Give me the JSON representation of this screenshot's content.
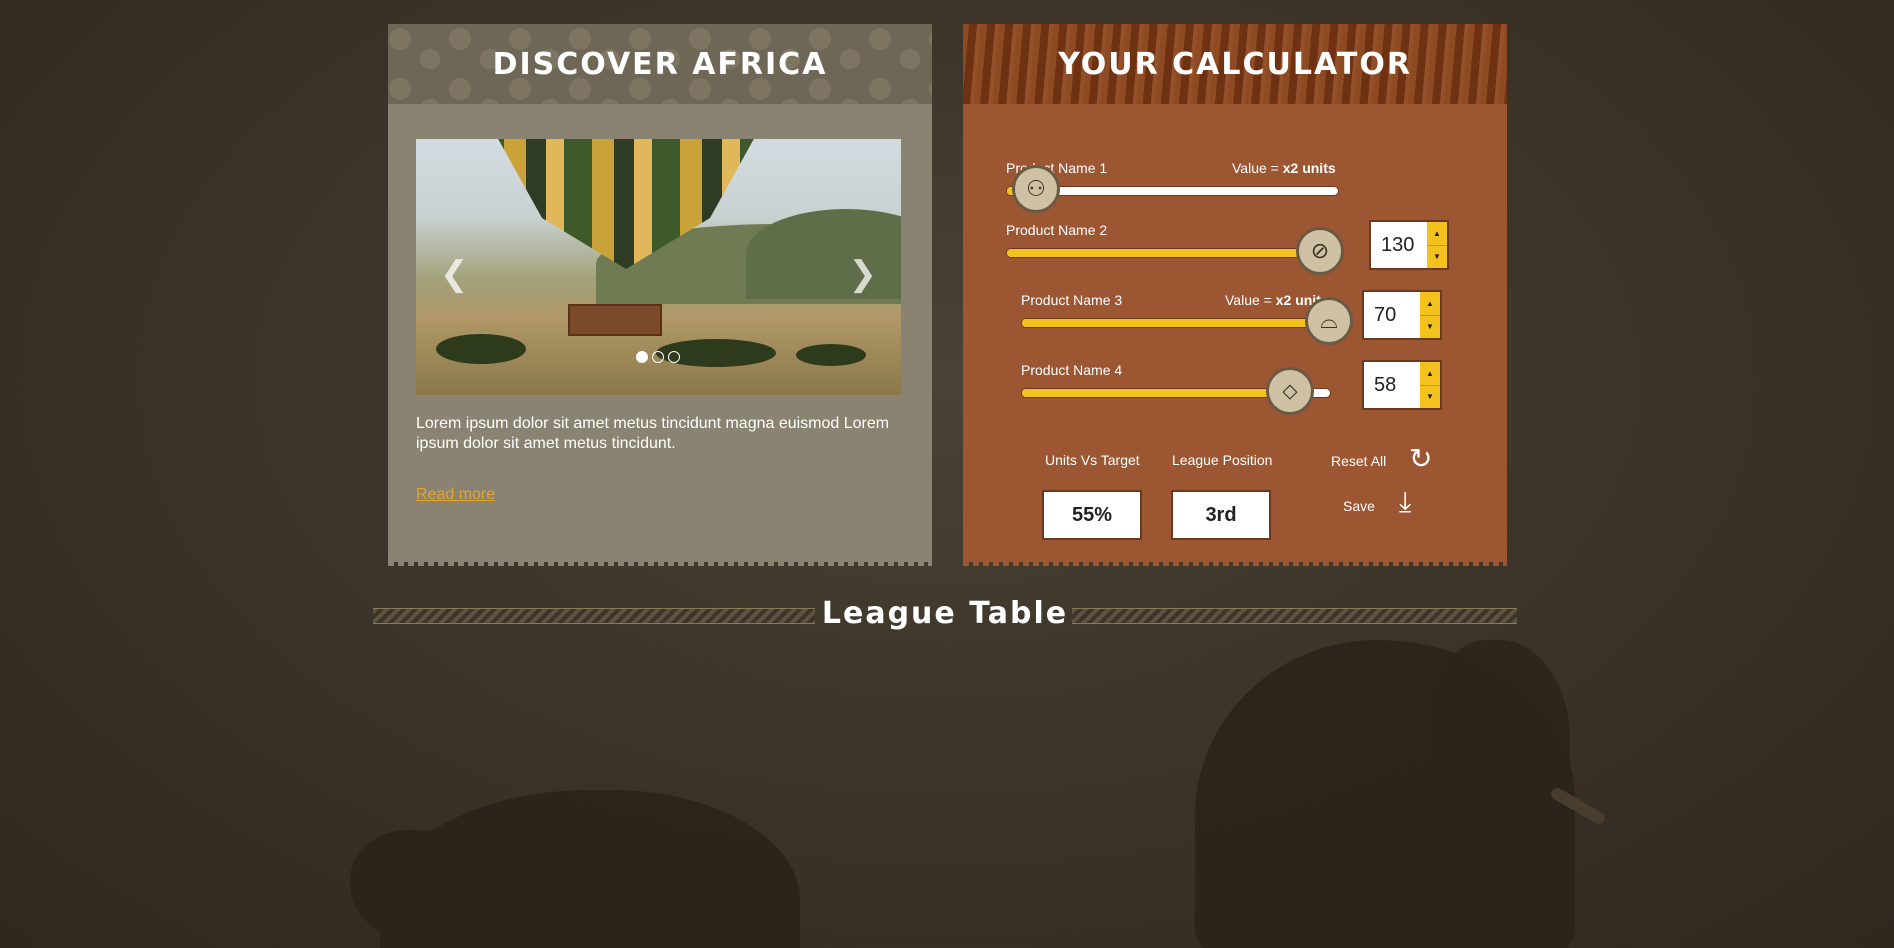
{
  "discover": {
    "title": "Discover Africa",
    "description": "Lorem ipsum dolor sit amet metus tincidunt magna euismod Lorem ipsum dolor sit amet metus tincidunt.",
    "read_more": "Read more",
    "carousel": {
      "slides": 3,
      "active": 1,
      "prev_icon": "chevron-left-icon",
      "next_icon": "chevron-right-icon"
    }
  },
  "calculator": {
    "title": "Your Calculator",
    "products": [
      {
        "name": "Product Name 1",
        "value_prefix": "Value = ",
        "value_bold": "x2 units",
        "slider_fraction": 0.02,
        "icon": "binoculars-icon",
        "icon_glyph": "⚇"
      },
      {
        "name": "Product Name 2",
        "quantity": "130",
        "slider_fraction": 0.96,
        "icon": "compass-icon",
        "icon_glyph": "⊘"
      },
      {
        "name": "Product Name 3",
        "value_prefix": "Value = ",
        "value_bold": "x2 units",
        "quantity": "70",
        "slider_fraction": 0.99,
        "icon": "safari-hat-icon",
        "icon_glyph": "⌓"
      },
      {
        "name": "Product Name 4",
        "quantity": "58",
        "slider_fraction": 0.85,
        "icon": "flask-icon",
        "icon_glyph": "⬦"
      }
    ],
    "units_vs_target_label": "Units Vs Target",
    "units_vs_target": "55%",
    "league_position_label": "League Position",
    "league_position": "3rd",
    "reset_label": "Reset All",
    "reset_icon": "↻",
    "save_label": "Save",
    "save_icon": "⤓"
  },
  "league": {
    "title": "League Table"
  },
  "colors": {
    "accent": "#f4c21d",
    "calculator_bg": "#9c5632",
    "discover_bg": "#8b8371",
    "link": "#e2a52a"
  }
}
